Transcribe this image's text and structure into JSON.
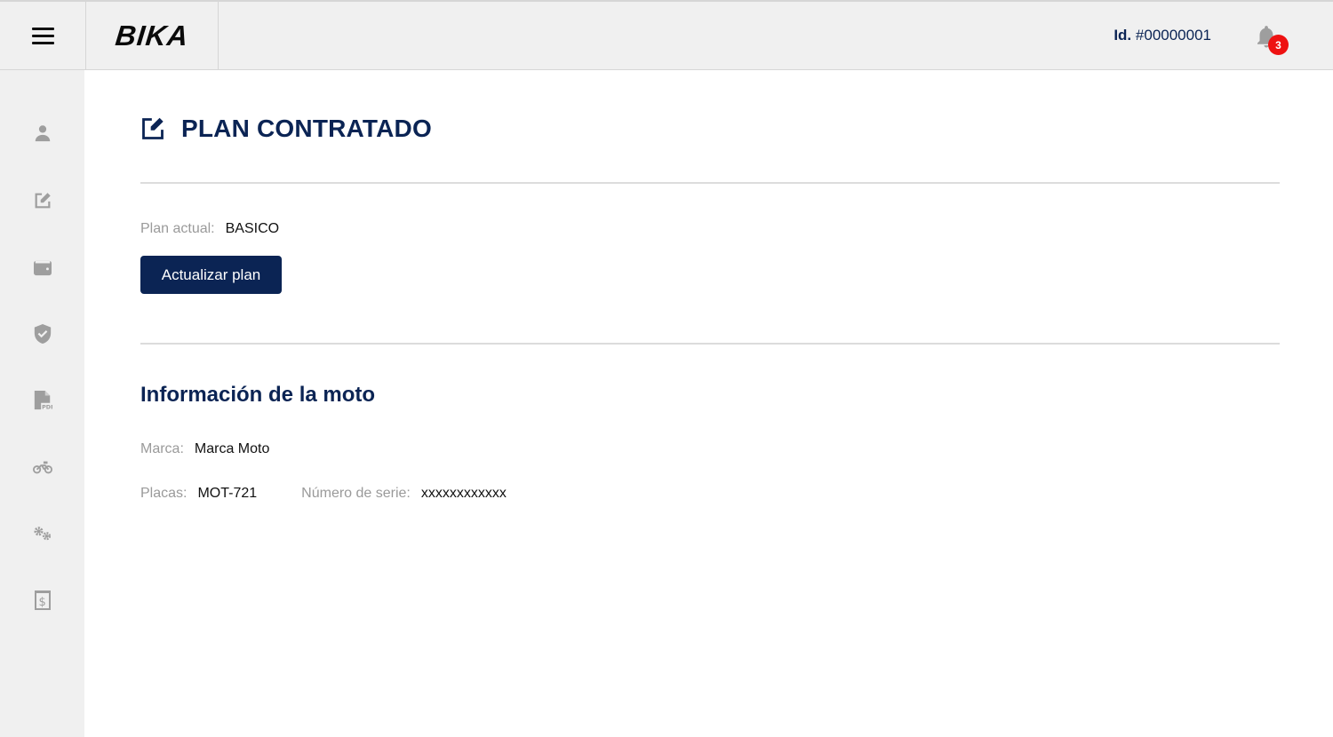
{
  "header": {
    "logo": "BIKA",
    "id_label": "Id.",
    "id_value": "#00000001",
    "notification_count": "3"
  },
  "sidebar": {
    "items": [
      {
        "icon": "user-icon"
      },
      {
        "icon": "edit-icon"
      },
      {
        "icon": "wallet-icon"
      },
      {
        "icon": "shield-check-icon"
      },
      {
        "icon": "pdf-file-icon"
      },
      {
        "icon": "motorcycle-icon"
      },
      {
        "icon": "gears-icon"
      },
      {
        "icon": "invoice-dollar-icon"
      }
    ]
  },
  "main": {
    "title": "PLAN CONTRATADO",
    "plan_label": "Plan actual:",
    "plan_value": "BASICO",
    "update_button": "Actualizar plan",
    "moto_section_title": "Información de la moto",
    "marca_label": "Marca:",
    "marca_value": "Marca Moto",
    "placas_label": "Placas:",
    "placas_value": "MOT-721",
    "serie_label": "Número de serie:",
    "serie_value": "xxxxxxxxxxxx"
  },
  "colors": {
    "primary": "#0b2454",
    "sidebar_bg": "#f0f0f0",
    "badge": "#ee1111",
    "icon_gray": "#9e9e9e"
  }
}
